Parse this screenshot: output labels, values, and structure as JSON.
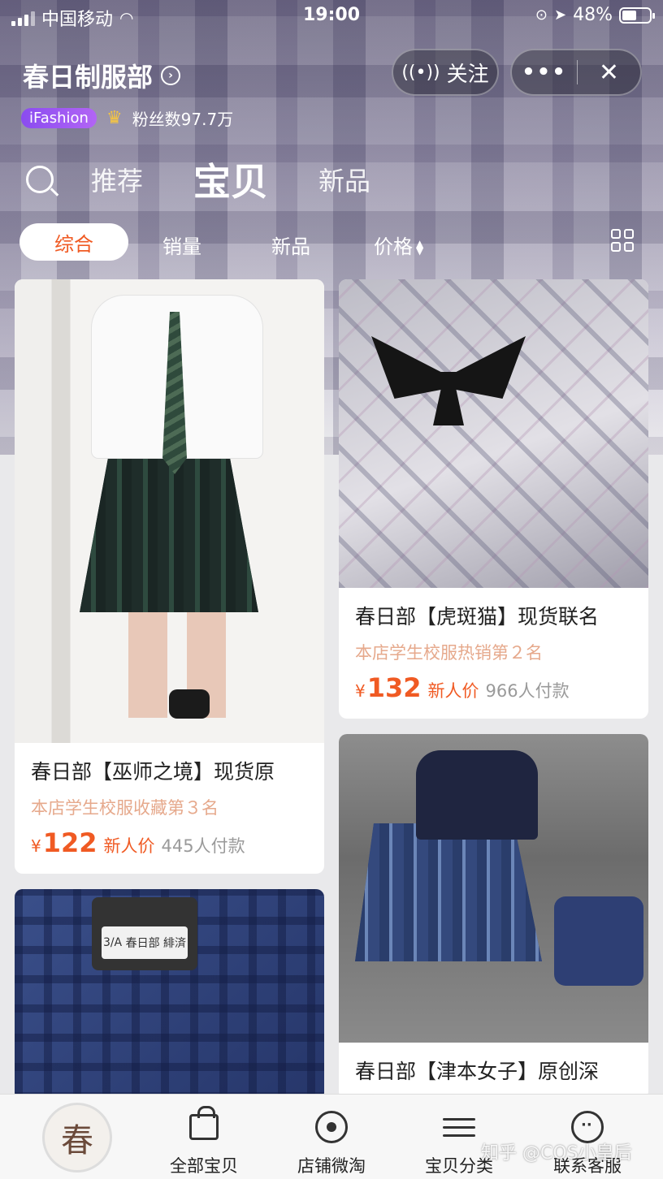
{
  "status_bar": {
    "carrier": "中国移动",
    "time": "19:00",
    "battery": "48%"
  },
  "store": {
    "name": "春日制服部",
    "badge": "iFashion",
    "fans": "粉丝数97.7万",
    "follow_label": "关注",
    "more_label": "•••",
    "close_label": "✕"
  },
  "main_tabs": [
    {
      "label": "推荐",
      "active": false
    },
    {
      "label": "宝贝",
      "active": true
    },
    {
      "label": "新品",
      "active": false
    }
  ],
  "sort_bar": {
    "items": [
      "综合",
      "销量",
      "新品",
      "价格"
    ],
    "selected": "综合",
    "accent": "#f05a23"
  },
  "products": [
    {
      "title": "春日部【巫师之境】现货原",
      "rank": "本店学生校服收藏第３名",
      "yen": "¥",
      "price": "122",
      "price_tag": "新人价",
      "paid": "445人付款"
    },
    {
      "title": "春日部【虎斑猫】现货联名",
      "rank": "本店学生校服热销第２名",
      "yen": "¥",
      "price": "132",
      "price_tag": "新人价",
      "paid": "966人付款"
    },
    {
      "title": "春日部【津本女子】原创深"
    }
  ],
  "image_text": {
    "badge_class": "3/A",
    "badge_name": "春日部 緋済"
  },
  "bottom_nav": {
    "logo_char": "春",
    "items": [
      {
        "label": "全部宝贝",
        "icon": "shopping-bag-icon"
      },
      {
        "label": "店铺微淘",
        "icon": "live-broadcast-icon"
      },
      {
        "label": "宝贝分类",
        "icon": "category-list-icon"
      },
      {
        "label": "联系客服",
        "icon": "chat-bubble-icon"
      }
    ]
  },
  "watermark": "知乎 @COS小皇后"
}
